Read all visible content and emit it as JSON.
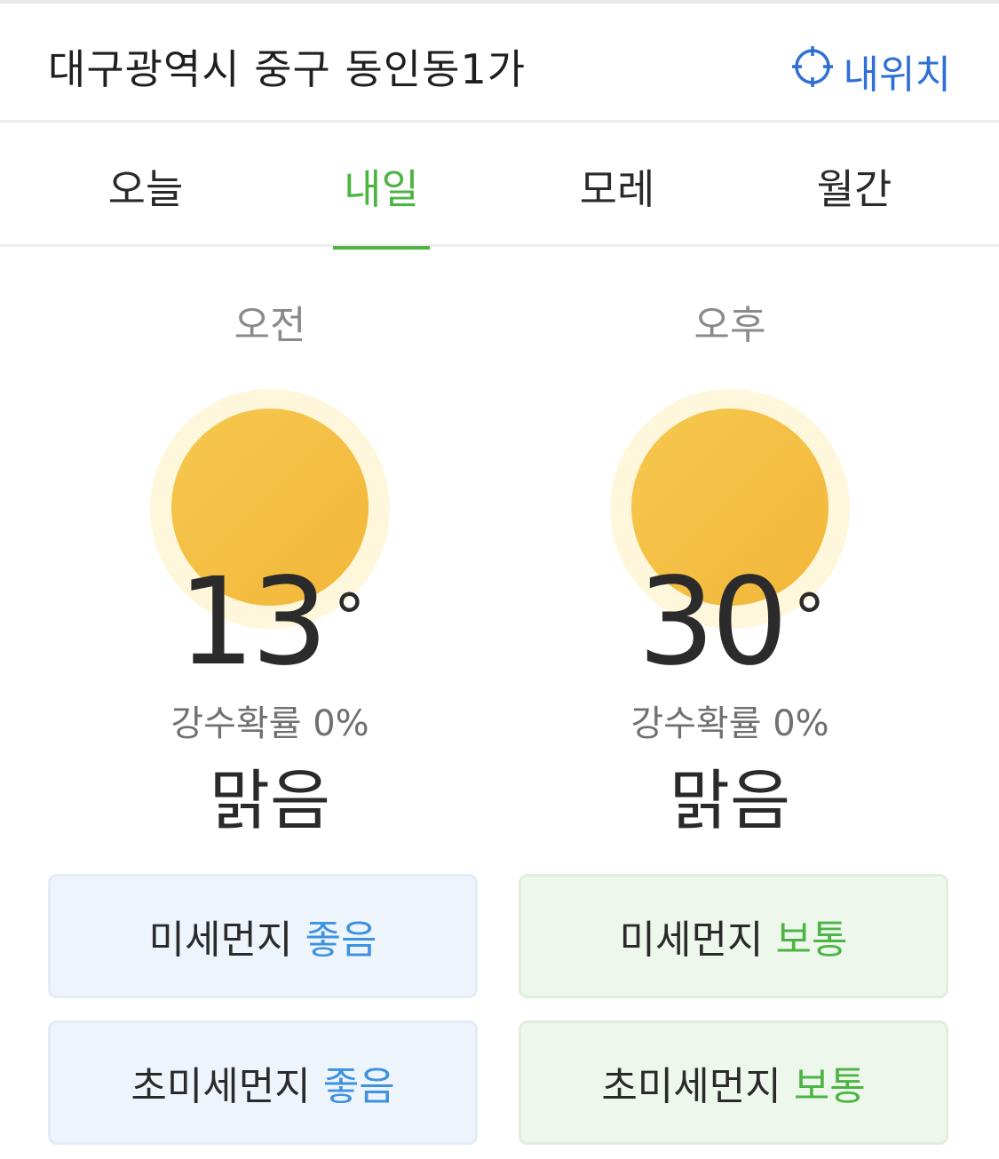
{
  "header": {
    "location": "대구광역시 중구 동인동1가",
    "my_location": "내위치"
  },
  "tabs": [
    {
      "label": "오늘",
      "active": false
    },
    {
      "label": "내일",
      "active": true
    },
    {
      "label": "모레",
      "active": false
    },
    {
      "label": "월간",
      "active": false
    }
  ],
  "forecast": {
    "am": {
      "period": "오전",
      "temp": "13",
      "deg": "°",
      "rain": "강수확률 0%",
      "condition": "맑음",
      "icon": "sun-icon"
    },
    "pm": {
      "period": "오후",
      "temp": "30",
      "deg": "°",
      "rain": "강수확률 0%",
      "condition": "맑음",
      "icon": "sun-icon"
    }
  },
  "air": {
    "am": [
      {
        "label": "미세먼지",
        "status": "좋음"
      },
      {
        "label": "초미세먼지",
        "status": "좋음"
      }
    ],
    "pm": [
      {
        "label": "미세먼지",
        "status": "보통"
      },
      {
        "label": "초미세먼지",
        "status": "보통"
      }
    ]
  },
  "colors": {
    "accent_green": "#4cb443",
    "link_blue": "#2f6fd6",
    "good_blue": "#3d92e0",
    "sun_yellow": "#f4c043"
  }
}
